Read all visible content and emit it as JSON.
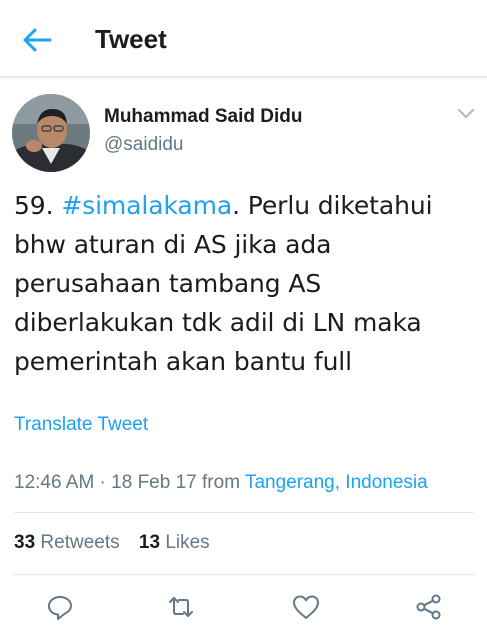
{
  "header": {
    "title": "Tweet",
    "back_icon": "arrow-left-icon"
  },
  "author": {
    "name": "Muhammad Said Didu",
    "handle": "@saididu"
  },
  "tweet": {
    "lines": [
      {
        "prefix": "59. ",
        "hashtag": "#simalakama",
        "suffix": ". Perlu diketahui"
      },
      {
        "text": "bhw aturan di AS jika ada"
      },
      {
        "text": "perusahaan tambang AS"
      },
      {
        "text": "diberlakukan tdk adil di LN maka"
      },
      {
        "text": "pemerintah akan bantu full"
      }
    ],
    "translate_label": "Translate Tweet",
    "time": "12:46 AM · 18 Feb 17",
    "from_label": "from",
    "location": "Tangerang, Indonesia"
  },
  "stats": {
    "retweets_count": "33",
    "retweets_label": "Retweets",
    "likes_count": "13",
    "likes_label": "Likes"
  },
  "actions": [
    "reply-icon",
    "retweet-icon",
    "like-icon",
    "share-icon"
  ],
  "colors": {
    "accent": "#1da1f2",
    "muted": "#657786",
    "divider": "#e1e8ed"
  }
}
